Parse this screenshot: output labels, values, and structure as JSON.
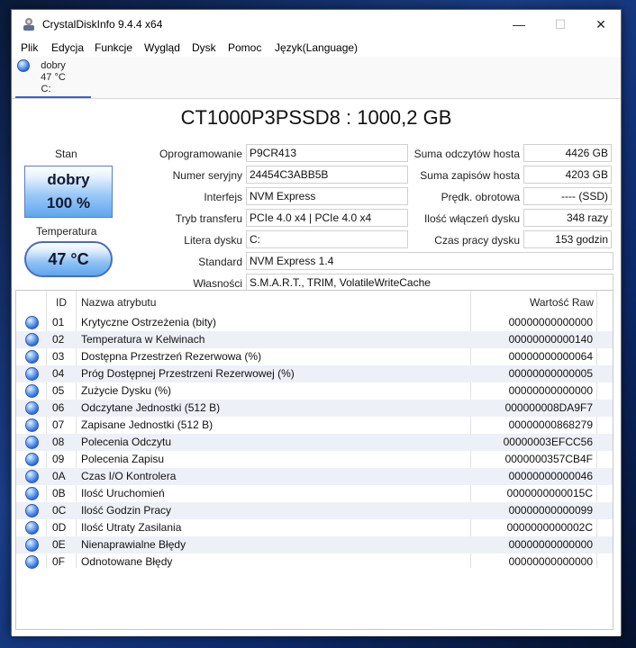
{
  "window": {
    "title": "CrystalDiskInfo 9.4.4 x64",
    "minimize_icon": "minimize-icon",
    "maximize_icon": "maximize-icon",
    "close_icon": "close-icon"
  },
  "menu": [
    "Plik",
    "Edycja",
    "Funkcje",
    "Wygląd",
    "Dysk",
    "Pomoc",
    "Język(Language)"
  ],
  "drive_tab": {
    "status": "dobry",
    "temp": "47 °C",
    "letter": "C:",
    "icon": "health-status-icon"
  },
  "disk": {
    "model": "CT1000P3PSSD8 : 1000,2 GB",
    "status_label": "Stan",
    "status_word": "dobry",
    "status_percent": "100 %",
    "temp_label": "Temperatura",
    "temperature": "47 °C",
    "firmware_label": "Oprogramowanie",
    "firmware": "P9CR413",
    "serial_label": "Numer seryjny",
    "serial": "24454C3ABB5B",
    "interface_label": "Interfejs",
    "interface": "NVM Express",
    "transfer_label": "Tryb transferu",
    "transfer": "PCIe 4.0 x4 | PCIe 4.0 x4",
    "letter_label": "Litera dysku",
    "letter": "C:",
    "standard_label": "Standard",
    "standard": "NVM Express 1.4",
    "features_label": "Własności",
    "features": "S.M.A.R.T., TRIM, VolatileWriteCache",
    "host_reads_label": "Suma odczytów hosta",
    "host_reads": "4426 GB",
    "host_writes_label": "Suma zapisów hosta",
    "host_writes": "4203 GB",
    "rotation_label": "Prędk. obrotowa",
    "rotation": "---- (SSD)",
    "power_on_count_label": "Ilość włączeń dysku",
    "power_on_count": "348 razy",
    "power_on_hours_label": "Czas pracy dysku",
    "power_on_hours": "153 godzin"
  },
  "smart": {
    "headers": {
      "id": "ID",
      "name": "Nazwa atrybutu",
      "raw": "Wartość Raw"
    },
    "rows": [
      {
        "id": "01",
        "name": "Krytyczne Ostrzeżenia (bity)",
        "raw": "00000000000000"
      },
      {
        "id": "02",
        "name": "Temperatura w Kelwinach",
        "raw": "00000000000140"
      },
      {
        "id": "03",
        "name": "Dostępna Przestrzeń Rezerwowa (%)",
        "raw": "00000000000064"
      },
      {
        "id": "04",
        "name": "Próg Dostępnej Przestrzeni Rezerwowej (%)",
        "raw": "00000000000005"
      },
      {
        "id": "05",
        "name": "Zużycie Dysku (%)",
        "raw": "00000000000000"
      },
      {
        "id": "06",
        "name": "Odczytane Jednostki (512 B)",
        "raw": "000000008DA9F7"
      },
      {
        "id": "07",
        "name": "Zapisane Jednostki (512 B)",
        "raw": "00000000868279"
      },
      {
        "id": "08",
        "name": "Polecenia Odczytu",
        "raw": "00000003EFCC56"
      },
      {
        "id": "09",
        "name": "Polecenia Zapisu",
        "raw": "0000000357CB4F"
      },
      {
        "id": "0A",
        "name": "Czas I/O Kontrolera",
        "raw": "00000000000046"
      },
      {
        "id": "0B",
        "name": "Ilość Uruchomień",
        "raw": "0000000000015C"
      },
      {
        "id": "0C",
        "name": "Ilość Godzin Pracy",
        "raw": "00000000000099"
      },
      {
        "id": "0D",
        "name": "Ilość Utraty Zasilania",
        "raw": "0000000000002C"
      },
      {
        "id": "0E",
        "name": "Nienaprawialne Błędy",
        "raw": "00000000000000"
      },
      {
        "id": "0F",
        "name": "Odnotowane Błędy",
        "raw": "00000000000000"
      }
    ]
  },
  "colors": {
    "accent": "#3b5fd0",
    "good_blue": "#5ea6ee",
    "row_alt": "#eef0f8"
  }
}
